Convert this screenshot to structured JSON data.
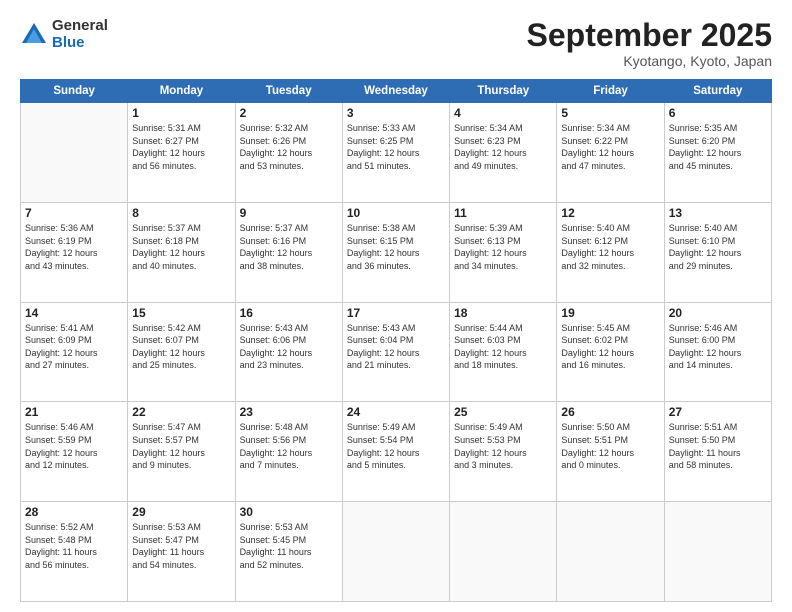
{
  "logo": {
    "general": "General",
    "blue": "Blue"
  },
  "header": {
    "month": "September 2025",
    "location": "Kyotango, Kyoto, Japan"
  },
  "weekdays": [
    "Sunday",
    "Monday",
    "Tuesday",
    "Wednesday",
    "Thursday",
    "Friday",
    "Saturday"
  ],
  "weeks": [
    [
      {
        "day": "",
        "info": ""
      },
      {
        "day": "1",
        "info": "Sunrise: 5:31 AM\nSunset: 6:27 PM\nDaylight: 12 hours\nand 56 minutes."
      },
      {
        "day": "2",
        "info": "Sunrise: 5:32 AM\nSunset: 6:26 PM\nDaylight: 12 hours\nand 53 minutes."
      },
      {
        "day": "3",
        "info": "Sunrise: 5:33 AM\nSunset: 6:25 PM\nDaylight: 12 hours\nand 51 minutes."
      },
      {
        "day": "4",
        "info": "Sunrise: 5:34 AM\nSunset: 6:23 PM\nDaylight: 12 hours\nand 49 minutes."
      },
      {
        "day": "5",
        "info": "Sunrise: 5:34 AM\nSunset: 6:22 PM\nDaylight: 12 hours\nand 47 minutes."
      },
      {
        "day": "6",
        "info": "Sunrise: 5:35 AM\nSunset: 6:20 PM\nDaylight: 12 hours\nand 45 minutes."
      }
    ],
    [
      {
        "day": "7",
        "info": "Sunrise: 5:36 AM\nSunset: 6:19 PM\nDaylight: 12 hours\nand 43 minutes."
      },
      {
        "day": "8",
        "info": "Sunrise: 5:37 AM\nSunset: 6:18 PM\nDaylight: 12 hours\nand 40 minutes."
      },
      {
        "day": "9",
        "info": "Sunrise: 5:37 AM\nSunset: 6:16 PM\nDaylight: 12 hours\nand 38 minutes."
      },
      {
        "day": "10",
        "info": "Sunrise: 5:38 AM\nSunset: 6:15 PM\nDaylight: 12 hours\nand 36 minutes."
      },
      {
        "day": "11",
        "info": "Sunrise: 5:39 AM\nSunset: 6:13 PM\nDaylight: 12 hours\nand 34 minutes."
      },
      {
        "day": "12",
        "info": "Sunrise: 5:40 AM\nSunset: 6:12 PM\nDaylight: 12 hours\nand 32 minutes."
      },
      {
        "day": "13",
        "info": "Sunrise: 5:40 AM\nSunset: 6:10 PM\nDaylight: 12 hours\nand 29 minutes."
      }
    ],
    [
      {
        "day": "14",
        "info": "Sunrise: 5:41 AM\nSunset: 6:09 PM\nDaylight: 12 hours\nand 27 minutes."
      },
      {
        "day": "15",
        "info": "Sunrise: 5:42 AM\nSunset: 6:07 PM\nDaylight: 12 hours\nand 25 minutes."
      },
      {
        "day": "16",
        "info": "Sunrise: 5:43 AM\nSunset: 6:06 PM\nDaylight: 12 hours\nand 23 minutes."
      },
      {
        "day": "17",
        "info": "Sunrise: 5:43 AM\nSunset: 6:04 PM\nDaylight: 12 hours\nand 21 minutes."
      },
      {
        "day": "18",
        "info": "Sunrise: 5:44 AM\nSunset: 6:03 PM\nDaylight: 12 hours\nand 18 minutes."
      },
      {
        "day": "19",
        "info": "Sunrise: 5:45 AM\nSunset: 6:02 PM\nDaylight: 12 hours\nand 16 minutes."
      },
      {
        "day": "20",
        "info": "Sunrise: 5:46 AM\nSunset: 6:00 PM\nDaylight: 12 hours\nand 14 minutes."
      }
    ],
    [
      {
        "day": "21",
        "info": "Sunrise: 5:46 AM\nSunset: 5:59 PM\nDaylight: 12 hours\nand 12 minutes."
      },
      {
        "day": "22",
        "info": "Sunrise: 5:47 AM\nSunset: 5:57 PM\nDaylight: 12 hours\nand 9 minutes."
      },
      {
        "day": "23",
        "info": "Sunrise: 5:48 AM\nSunset: 5:56 PM\nDaylight: 12 hours\nand 7 minutes."
      },
      {
        "day": "24",
        "info": "Sunrise: 5:49 AM\nSunset: 5:54 PM\nDaylight: 12 hours\nand 5 minutes."
      },
      {
        "day": "25",
        "info": "Sunrise: 5:49 AM\nSunset: 5:53 PM\nDaylight: 12 hours\nand 3 minutes."
      },
      {
        "day": "26",
        "info": "Sunrise: 5:50 AM\nSunset: 5:51 PM\nDaylight: 12 hours\nand 0 minutes."
      },
      {
        "day": "27",
        "info": "Sunrise: 5:51 AM\nSunset: 5:50 PM\nDaylight: 11 hours\nand 58 minutes."
      }
    ],
    [
      {
        "day": "28",
        "info": "Sunrise: 5:52 AM\nSunset: 5:48 PM\nDaylight: 11 hours\nand 56 minutes."
      },
      {
        "day": "29",
        "info": "Sunrise: 5:53 AM\nSunset: 5:47 PM\nDaylight: 11 hours\nand 54 minutes."
      },
      {
        "day": "30",
        "info": "Sunrise: 5:53 AM\nSunset: 5:45 PM\nDaylight: 11 hours\nand 52 minutes."
      },
      {
        "day": "",
        "info": ""
      },
      {
        "day": "",
        "info": ""
      },
      {
        "day": "",
        "info": ""
      },
      {
        "day": "",
        "info": ""
      }
    ]
  ]
}
